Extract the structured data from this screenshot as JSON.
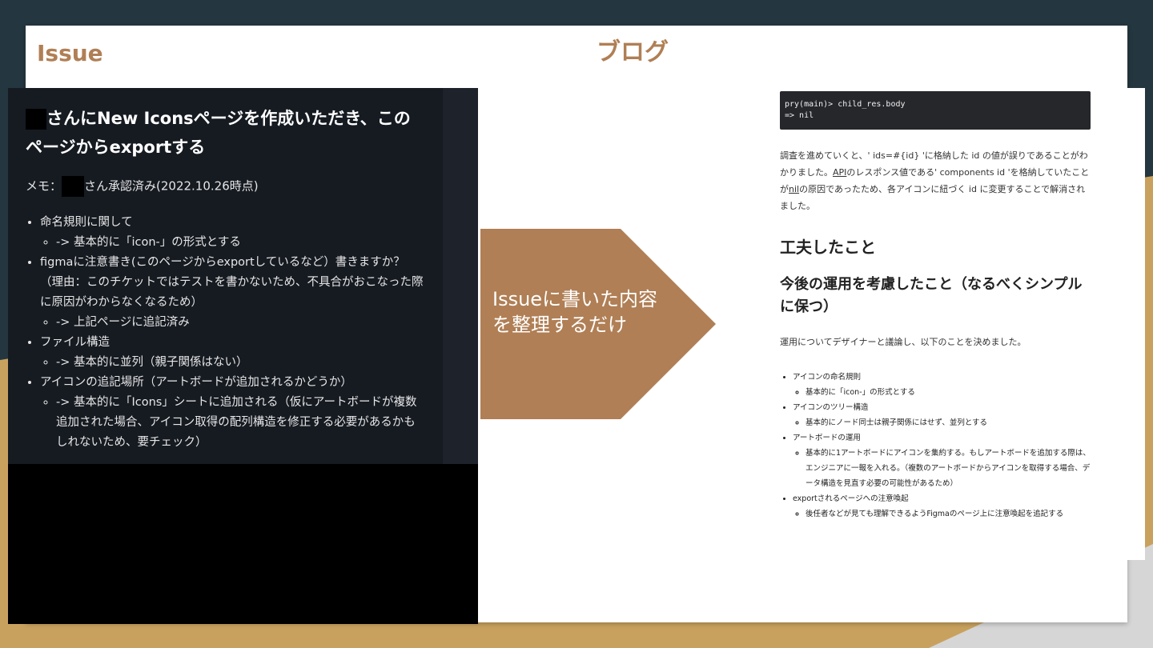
{
  "slide": {
    "issue_title": "Issue",
    "blog_title": "ブログ"
  },
  "issue": {
    "heading_rest": "さんにNew Iconsページを作成いただき、このページからexportする",
    "memo_prefix": "メモ：",
    "memo_rest": "さん承認済み(2022.10.26時点)",
    "items": [
      {
        "text": "命名規則に関して",
        "sub": "-> 基本的に「icon-」の形式とする"
      },
      {
        "text": "figmaに注意書き(このページからexportしているなど）書きますか？（理由：このチケットではテストを書かないため、不具合がおこなった際に原因がわからなくなるため）",
        "sub": "-> 上記ページに追記済み"
      },
      {
        "text": "ファイル構造",
        "sub": "-> 基本的に並列（親子関係はない）"
      },
      {
        "text": "アイコンの追記場所（アートボードが追加されるかどうか）",
        "sub": "-> 基本的に「Icons」シートに追加される（仮にアートボードが複数追加された場合、アイコン取得の配列構造を修正する必要があるかもしれないため、要チェック）"
      }
    ]
  },
  "arrow": {
    "text": "Issueに書いた内容を整理するだけ"
  },
  "blog": {
    "code_line1": "pry(main)> child_res.body",
    "code_line2": "=> nil",
    "para1_a": "調査を進めていくと、' ids=#{id} 'に格納した id の値が誤りであることがわかりました。",
    "para1_link1": "API",
    "para1_b": "のレスポンス値である' components id 'を格納していたことが",
    "para1_link2": "nil",
    "para1_c": "の原因であったため、各アイコンに紐づく id に変更することで解消されました。",
    "h2": "工夫したこと",
    "h3": "今後の運用を考慮したこと（なるべくシンプルに保つ）",
    "para2": "運用についてデザイナーと議論し、以下のことを決めました。",
    "items": [
      {
        "text": "アイコンの命名規則",
        "sub": "基本的に「icon-」の形式とする"
      },
      {
        "text": "アイコンのツリー構造",
        "sub": "基本的にノード同士は親子関係にはせず、並列とする"
      },
      {
        "text": "アートボードの運用",
        "sub": "基本的に1アートボードにアイコンを集約する。もしアートボードを追加する際は、エンジニアに一報を入れる。（複数のアートボードからアイコンを取得する場合、データ構造を見直す必要の可能性があるため）"
      },
      {
        "text": "exportされるページへの注意喚起",
        "sub": "後任者などが見ても理解できるようFigmaのページ上に注意喚起を追記する"
      }
    ]
  },
  "colors": {
    "accent": "#b07f55",
    "dark_bg": "#24363f",
    "gold": "#c9a15e",
    "panel": "#161b22"
  }
}
